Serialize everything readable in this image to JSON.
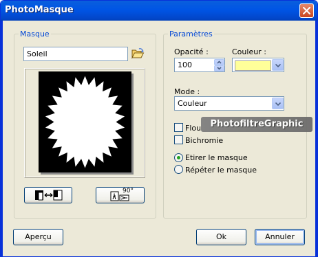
{
  "window": {
    "title": "PhotoMasque"
  },
  "masque": {
    "group_label": "Masque",
    "file_value": "Soleil"
  },
  "parametres": {
    "group_label": "Paramètres",
    "opacity_label": "Opacité :",
    "opacity_value": "100",
    "color_label": "Couleur :",
    "color_value": "#ffff99",
    "mode_label": "Mode :",
    "mode_value": "Couleur",
    "flou_label": "Flou",
    "flou_checked": false,
    "bichromie_label": "Bichromie",
    "bichromie_checked": false,
    "etirer_label": "Etirer le masque",
    "etirer_selected": true,
    "repeter_label": "Répéter le masque",
    "repeter_selected": false
  },
  "watermark": "PhotofiltreGraphic",
  "buttons": {
    "apercu": "Aperçu",
    "ok": "Ok",
    "annuler": "Annuler",
    "rotate_label": "90°"
  },
  "colors": {
    "title_bar": "#0055e5",
    "dialog_bg": "#ece9d8",
    "group_label": "#0046d5",
    "radio_dot": "#21a121"
  },
  "icons": [
    "close-icon",
    "folder-open-icon",
    "invert-mask-icon",
    "rotate-90-icon",
    "chevron-up-icon",
    "chevron-down-icon"
  ]
}
